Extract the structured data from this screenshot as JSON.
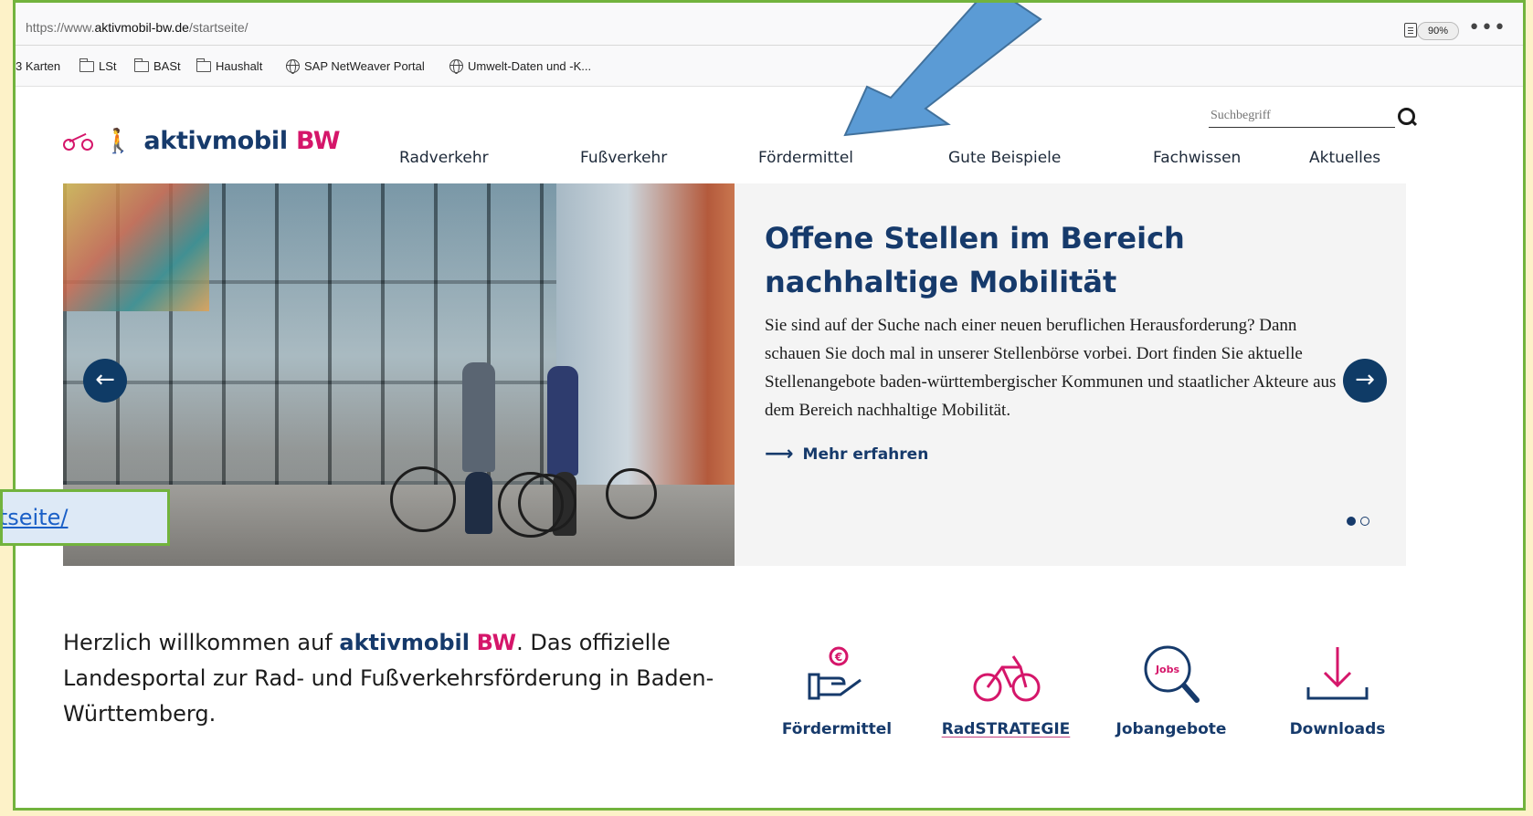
{
  "browser": {
    "url_prefix": "https://www.",
    "url_domain": "aktivmobil-bw.de",
    "url_path": "/startseite/",
    "zoom": "90%",
    "more": "•••"
  },
  "bookmarks": [
    {
      "label": "3 Karten",
      "icon": "none"
    },
    {
      "label": "LSt",
      "icon": "folder-icon"
    },
    {
      "label": "BASt",
      "icon": "folder-icon"
    },
    {
      "label": "Haushalt",
      "icon": "folder-icon"
    },
    {
      "label": "SAP NetWeaver Portal",
      "icon": "globe-icon"
    },
    {
      "label": "Umwelt-Daten und -K...",
      "icon": "globe-icon"
    }
  ],
  "site": {
    "search_placeholder": "Suchbegriff",
    "logo_main": "aktivmobil",
    "logo_accent": "BW",
    "nav": [
      "Radverkehr",
      "Fußverkehr",
      "Fördermittel",
      "Gute Beispiele",
      "Fachwissen",
      "Aktuelles"
    ]
  },
  "slider": {
    "title": "Offene Stellen im Bereich nachhaltige Mobilität",
    "body": "Sie sind auf der Suche nach einer neuen beruflichen Herausforderung? Dann schauen Sie doch mal in unserer Stellenbörse vorbei. Dort finden Sie aktuelle Stellenangebote baden-württembergischer Kommunen und staatlicher Akteure aus dem Bereich nachhaltige Mobilität.",
    "link": "Mehr erfahren",
    "prev": "←",
    "next": "→",
    "slide_count": 2,
    "active_slide": 1
  },
  "welcome": {
    "pre": "Herzlich willkommen auf ",
    "brand_a": "aktivmobil",
    "brand_b": "BW",
    "post": ". Das offizielle Landesportal zur Rad- und Fußverkehrsförderung in Baden-Württemberg."
  },
  "quicklinks": [
    {
      "label": "Fördermittel",
      "icon": "hand-euro-icon"
    },
    {
      "label": "RadSTRATEGIE",
      "icon": "bicycle-icon"
    },
    {
      "label": "Jobangebote",
      "icon": "jobs-search-icon",
      "icon_text": "Jobs"
    },
    {
      "label": "Downloads",
      "icon": "download-icon"
    }
  ],
  "annotation": {
    "link_text": "rtseite/",
    "arrow_color": "#5b9bd5",
    "border_color": "#72b33d"
  },
  "colors": {
    "brand_blue": "#163a6b",
    "brand_magenta": "#d5166a"
  }
}
